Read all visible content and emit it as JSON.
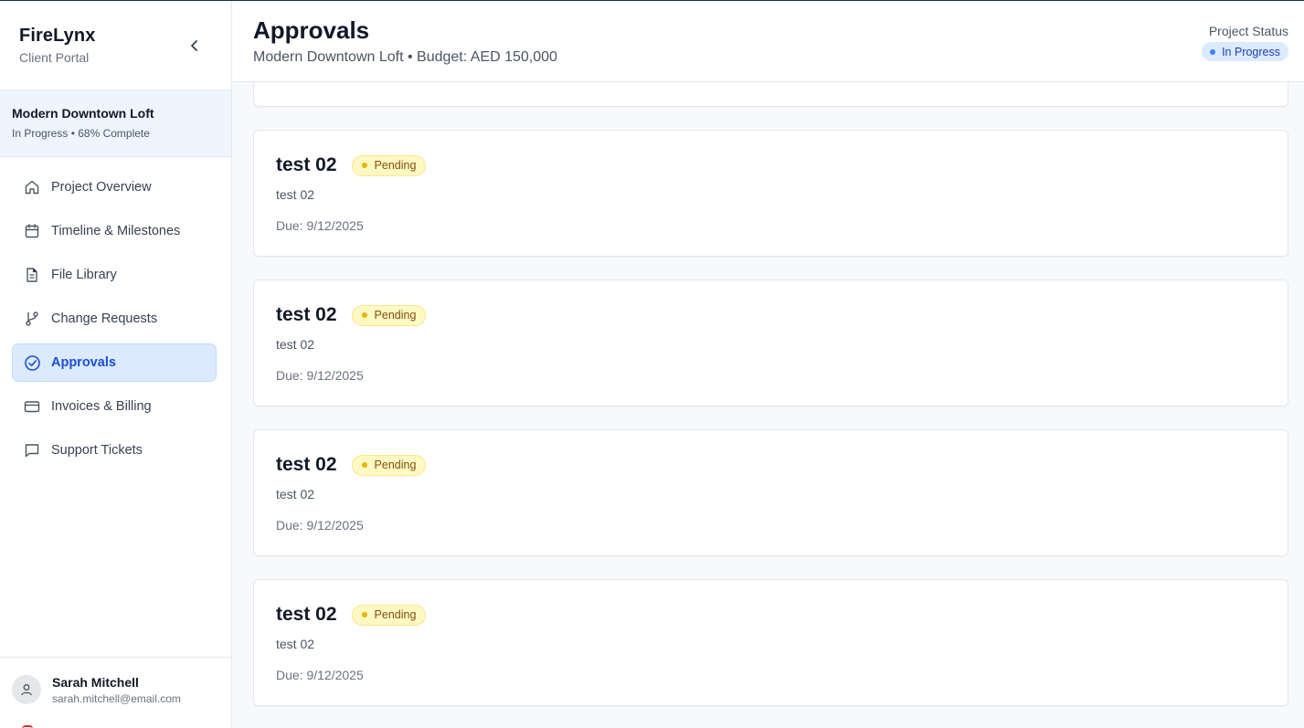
{
  "app": {
    "brand": "FireLynx",
    "subtitle": "Client Portal"
  },
  "project": {
    "name": "Modern Downtown Loft",
    "meta": "In Progress • 68% Complete"
  },
  "nav": [
    {
      "label": "Project Overview",
      "icon": "home-icon",
      "active": false
    },
    {
      "label": "Timeline & Milestones",
      "icon": "calendar-icon",
      "active": false
    },
    {
      "label": "File Library",
      "icon": "file-icon",
      "active": false
    },
    {
      "label": "Change Requests",
      "icon": "git-branch-icon",
      "active": false
    },
    {
      "label": "Approvals",
      "icon": "check-circle-icon",
      "active": true
    },
    {
      "label": "Invoices & Billing",
      "icon": "credit-card-icon",
      "active": false
    },
    {
      "label": "Support Tickets",
      "icon": "message-icon",
      "active": false
    }
  ],
  "user": {
    "name": "Sarah Mitchell",
    "email": "sarah.mitchell@email.com"
  },
  "header": {
    "title": "Approvals",
    "subtitle": "Modern Downtown Loft • Budget: AED 150,000",
    "status_label": "Project Status",
    "status_value": "In Progress"
  },
  "approvals": [
    {
      "title": "test 02",
      "status": "Pending",
      "description": "test 02",
      "due": "Due: 9/12/2025"
    },
    {
      "title": "test 02",
      "status": "Pending",
      "description": "test 02",
      "due": "Due: 9/12/2025"
    },
    {
      "title": "test 02",
      "status": "Pending",
      "description": "test 02",
      "due": "Due: 9/12/2025"
    },
    {
      "title": "test 02",
      "status": "Pending",
      "description": "test 02",
      "due": "Due: 9/12/2025"
    }
  ],
  "colors": {
    "accent": "#1d4ed8",
    "active_bg": "#dbeafe",
    "pending_bg": "#fef9c3",
    "pending_dot": "#eab308"
  }
}
